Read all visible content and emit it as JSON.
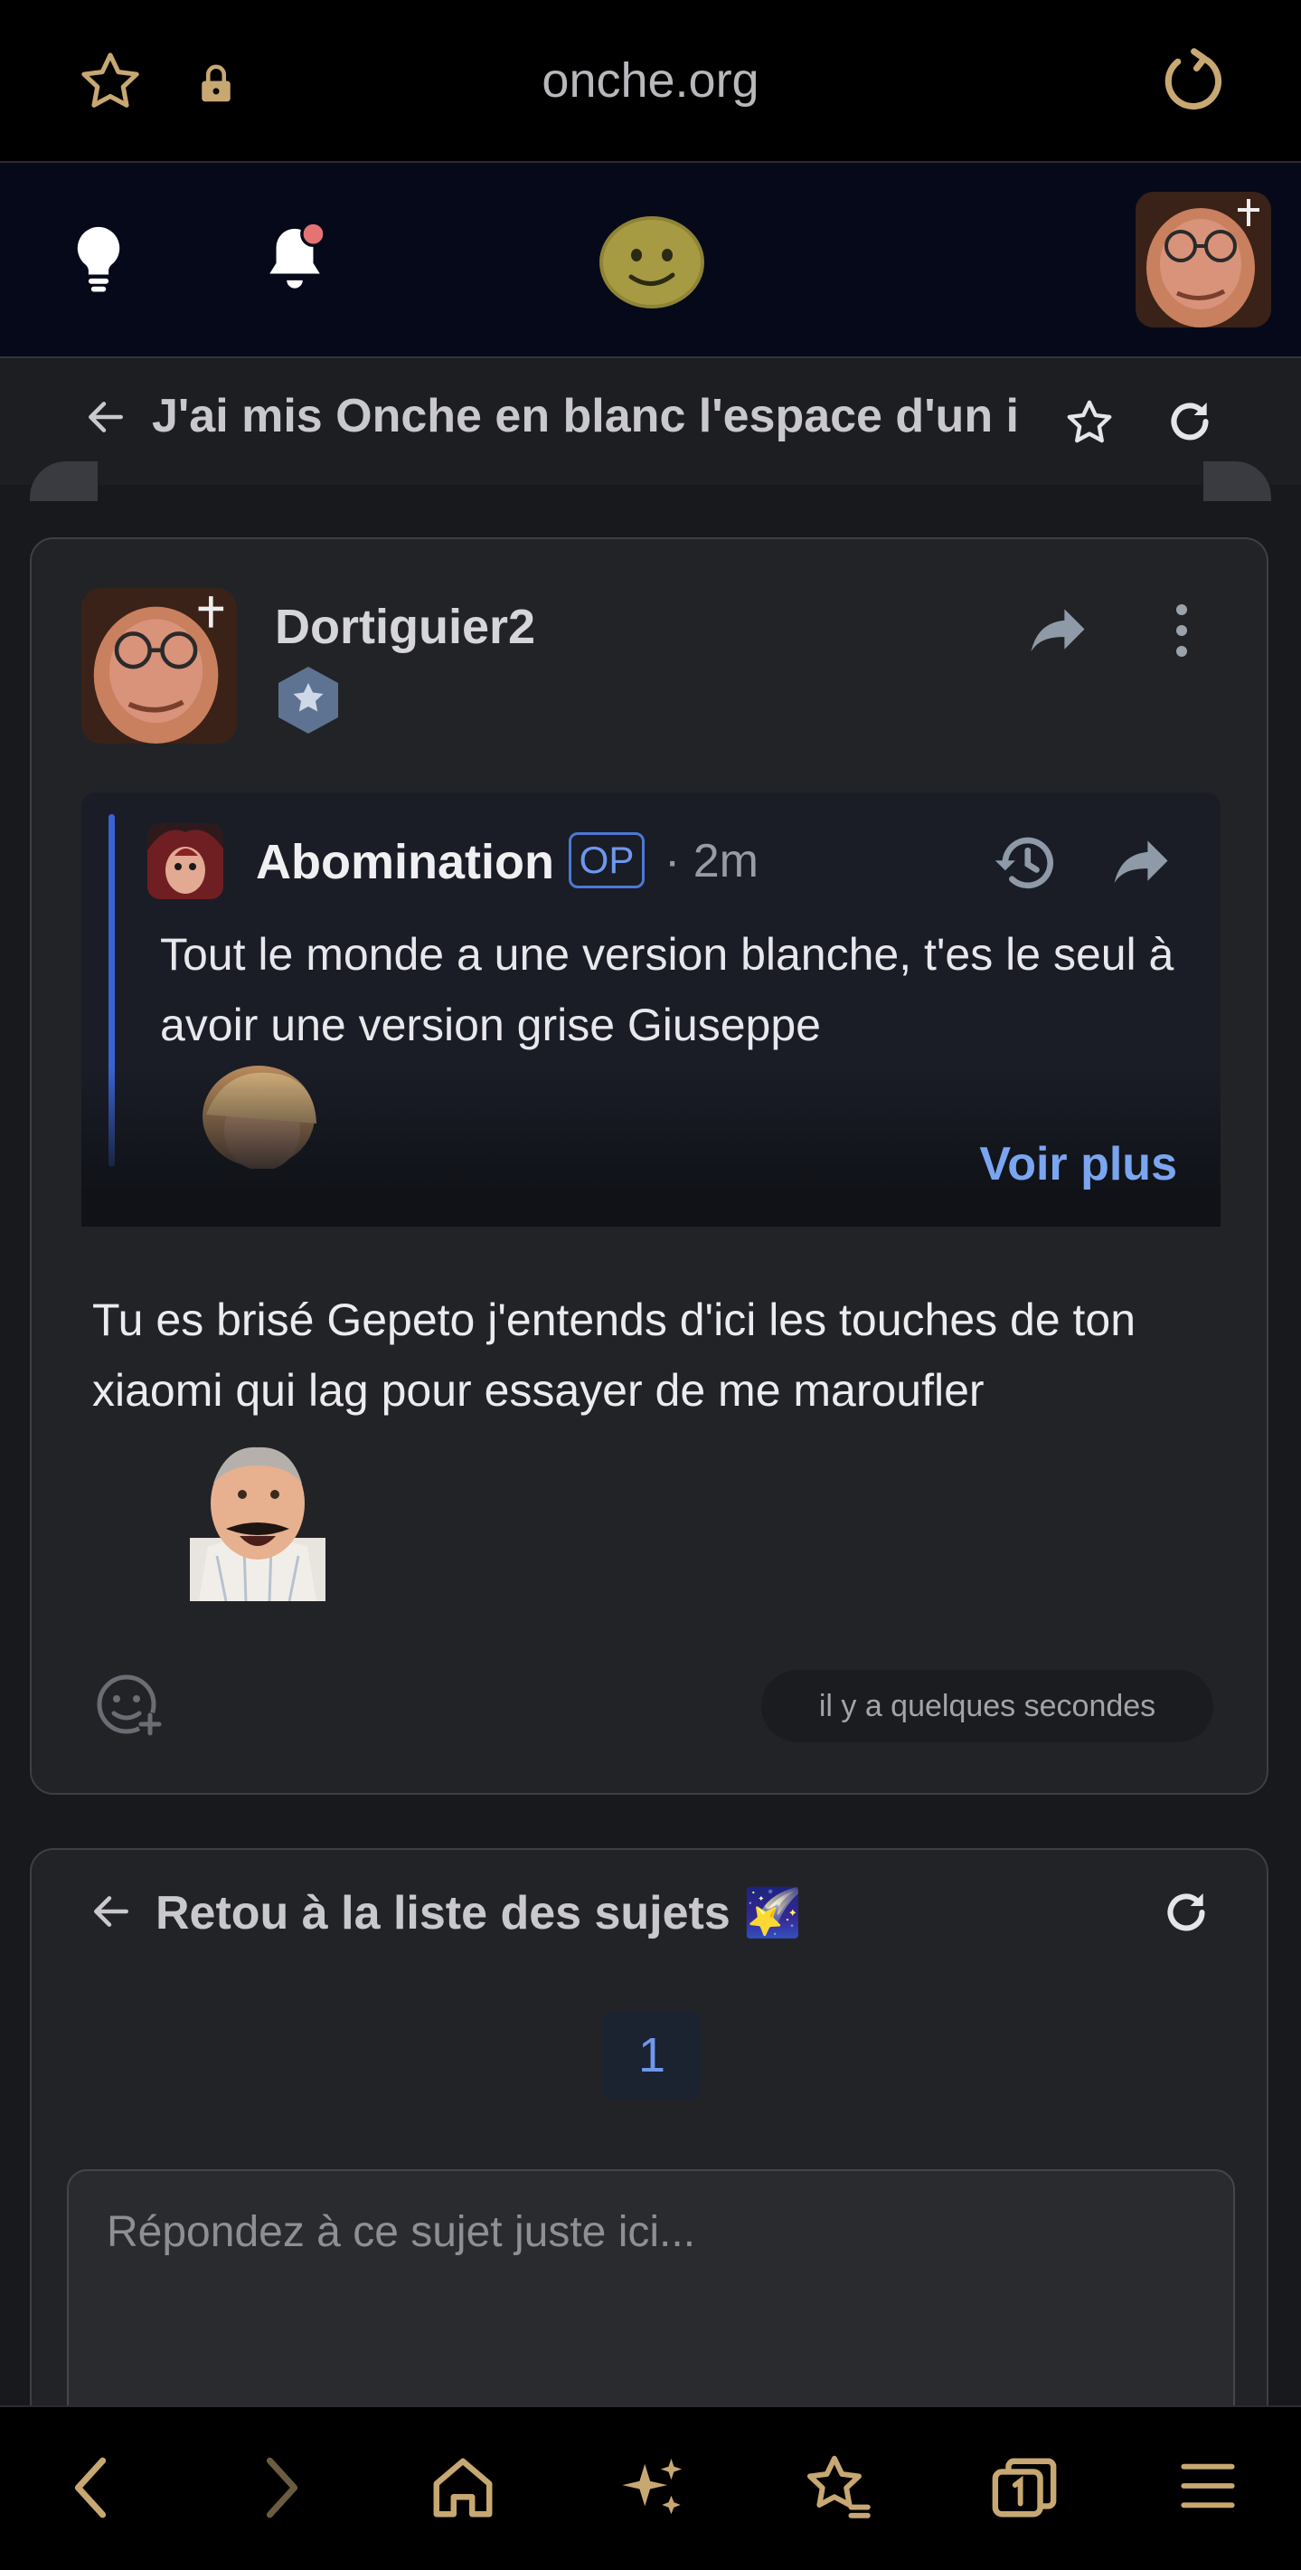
{
  "browser": {
    "url": "onche.org"
  },
  "topic": {
    "title": "J'ai mis Onche en blanc l'espace d'un i"
  },
  "post": {
    "author": "Dortiguier2",
    "quote": {
      "author": "Abomination",
      "op_badge": "OP",
      "time": "· 2m",
      "text": "Tout le monde a une version blanche, t'es le seul à avoir une version grise Giuseppe",
      "see_more": "Voir plus"
    },
    "text": "Tu es brisé Gepeto j'entends d'ici les touches de ton xiaomi qui lag pour essayer de me maroufler",
    "timestamp": "il y a quelques secondes"
  },
  "footer_card": {
    "back_label": "Retou à la liste des sujets",
    "back_emoji": "🌠",
    "page": "1",
    "reply_placeholder": "Répondez à ce sujet juste ici..."
  },
  "colors": {
    "accent": "#c8a872",
    "link": "#7aa5f0",
    "quote_bar": "#3b63d0",
    "notification": "#e57373"
  }
}
